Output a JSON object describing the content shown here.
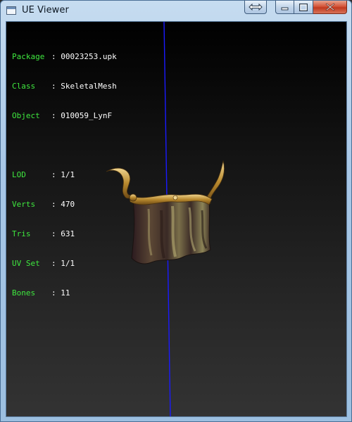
{
  "window": {
    "title": "UE Viewer",
    "controls": {
      "extra_icon": "swap-arrows-icon",
      "minimize_icon": "minimize-icon",
      "maximize_icon": "maximize-icon",
      "close_icon": "close-icon"
    }
  },
  "info": {
    "rows_top": [
      {
        "key": "Package",
        "sep": ":",
        "value": "00023253.upk"
      },
      {
        "key": "Class",
        "sep": ":",
        "value": "SkeletalMesh"
      },
      {
        "key": "Object",
        "sep": ":",
        "value": "010059_LynF"
      }
    ],
    "rows_bottom": [
      {
        "key": "LOD",
        "sep": ":",
        "value": "1/1"
      },
      {
        "key": "Verts",
        "sep": ":",
        "value": "470"
      },
      {
        "key": "Tris",
        "sep": ":",
        "value": "631"
      },
      {
        "key": "UV Set",
        "sep": ":",
        "value": "1/1"
      },
      {
        "key": "Bones",
        "sep": ":",
        "value": "11"
      }
    ],
    "key_color": "#3fe83f",
    "value_color": "#ffffff"
  },
  "viewport": {
    "axis_color": "#1a1aff",
    "model": "3d-armor-mesh"
  }
}
